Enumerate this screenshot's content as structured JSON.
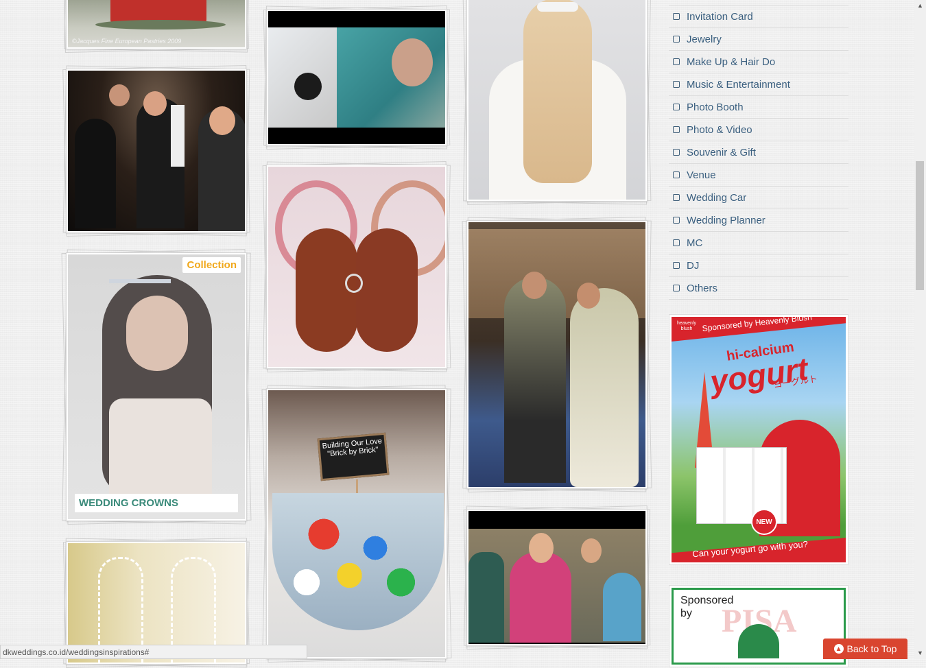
{
  "gallery": {
    "cake_watermark": "©Jacques Fine European Pastries 2009",
    "collection_badge": "Collection",
    "collection_title": "WEDDING CROWNS",
    "sign_text": "Building Our Love \"Brick by Brick\""
  },
  "categories": [
    {
      "label": "Invitation Card"
    },
    {
      "label": "Jewelry"
    },
    {
      "label": "Make Up & Hair Do"
    },
    {
      "label": "Music & Entertainment"
    },
    {
      "label": "Photo Booth"
    },
    {
      "label": "Photo & Video"
    },
    {
      "label": "Souvenir & Gift"
    },
    {
      "label": "Venue"
    },
    {
      "label": "Wedding Car"
    },
    {
      "label": "Wedding Planner"
    },
    {
      "label": "MC"
    },
    {
      "label": "DJ"
    },
    {
      "label": "Others"
    }
  ],
  "ads": {
    "yogurt": {
      "brand": "heavenly blush",
      "sponsored": "Sponsored by Heavenly Blush",
      "headline_small": "hi-calcium",
      "headline": "yogurt",
      "japanese": "ヨーグルト",
      "badge": "NEW",
      "tagline": "Can your yogurt go with you?"
    },
    "pisa": {
      "sponsored": "Sponsored by",
      "brand": "PISA"
    }
  },
  "statusbar": {
    "url": "dkweddings.co.id/weddingsinspirations#"
  },
  "back_to_top": {
    "label": "Back to Top"
  }
}
